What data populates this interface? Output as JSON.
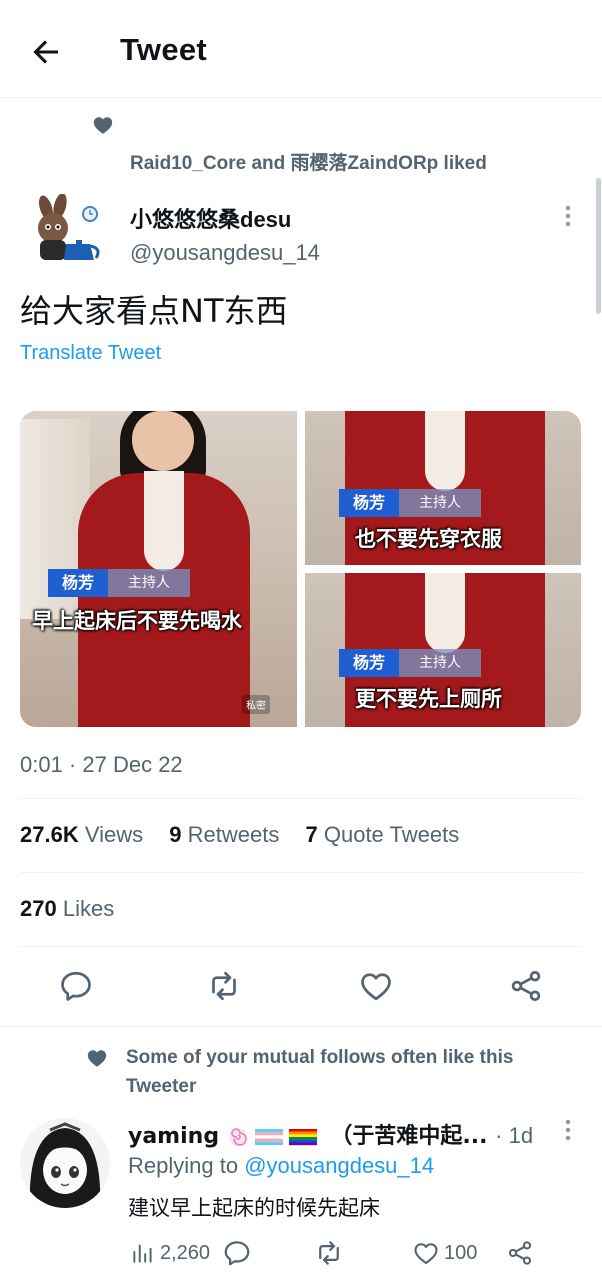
{
  "header": {
    "title": "Tweet"
  },
  "social_context": {
    "text": "Raid10_Core and 雨樱落ZaindORp liked"
  },
  "tweet": {
    "author_name": "小悠悠悠桑desu",
    "author_handle": "@yousangdesu_14",
    "text": "给大家看点NT东西",
    "translate_label": "Translate Tweet",
    "timestamp": "0:01 · 27 Dec 22",
    "media": [
      {
        "name_tag": "杨芳",
        "role_tag": "主持人",
        "caption": "早上起床后不要先喝水",
        "watermark": "私密"
      },
      {
        "name_tag": "杨芳",
        "role_tag": "主持人",
        "caption": "也不要先穿衣服"
      },
      {
        "name_tag": "杨芳",
        "role_tag": "主持人",
        "caption": "更不要先上厕所"
      }
    ],
    "stats": {
      "views_count": "27.6K",
      "views_label": "Views",
      "retweets_count": "9",
      "retweets_label": "Retweets",
      "quotes_count": "7",
      "quotes_label": "Quote Tweets",
      "likes_count": "270",
      "likes_label": "Likes"
    },
    "actions": [
      "reply-icon",
      "retweet-icon",
      "like-icon",
      "share-icon"
    ]
  },
  "reply_section": {
    "context_text": "Some of your mutual follows often like this Tweeter",
    "reply": {
      "author_name": "yaming",
      "author_name_suffix": "（于苦难中起...",
      "time": "· 1d",
      "replying_prefix": "Replying to",
      "replying_handle": "@yousangdesu_14",
      "text": "建议早上起床的时候先起床",
      "views": "2,260",
      "likes": "100"
    }
  },
  "colors": {
    "accent": "#1d9bf0",
    "secondary_text": "#536471",
    "primary_text": "#0f1419",
    "divider": "#eff3f4"
  }
}
